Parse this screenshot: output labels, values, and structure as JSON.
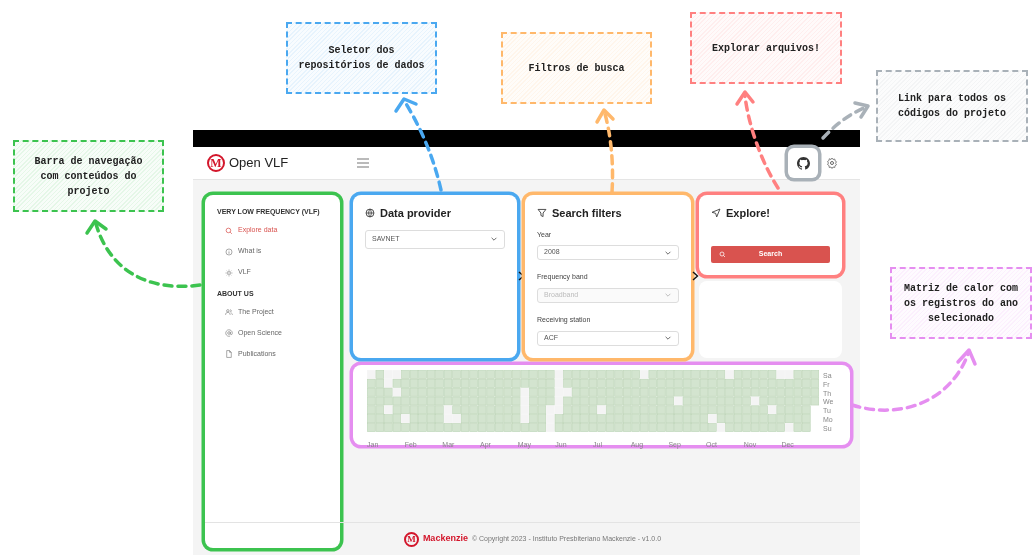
{
  "header": {
    "logo_letter": "M",
    "title": "Open VLF"
  },
  "sidebar": {
    "sections": [
      {
        "heading": "VERY LOW FREQUENCY (VLF)",
        "items": [
          {
            "label": "Explore data",
            "kind": "search",
            "selected": true
          },
          {
            "label": "What is",
            "kind": "info",
            "selected": false
          },
          {
            "label": "VLF",
            "kind": "sun",
            "selected": false
          }
        ]
      },
      {
        "heading": "ABOUT US",
        "items": [
          {
            "label": "The Project",
            "kind": "people",
            "selected": false
          },
          {
            "label": "Open Science",
            "kind": "at",
            "selected": false
          },
          {
            "label": "Publications",
            "kind": "file",
            "selected": false
          }
        ]
      }
    ]
  },
  "data_provider": {
    "title": "Data provider",
    "value": "SAVNET"
  },
  "search_filters": {
    "title": "Search filters",
    "fields": [
      {
        "label": "Year",
        "value": "2008",
        "disabled": false
      },
      {
        "label": "Frequency band",
        "value": "Broadband",
        "disabled": true
      },
      {
        "label": "Receiving station",
        "value": "ACF",
        "disabled": false
      }
    ]
  },
  "explore": {
    "title": "Explore!",
    "button": "Search"
  },
  "heatmap": {
    "months": [
      "Jan",
      "Feb",
      "Mar",
      "Apr",
      "May",
      "Jun",
      "Jul",
      "Aug",
      "Sep",
      "Oct",
      "Nov",
      "Dec"
    ],
    "days": [
      "Sa",
      "Fr",
      "Th",
      "We",
      "Tu",
      "Mo",
      "Su"
    ]
  },
  "footer": {
    "logo_letter": "M",
    "brand": "Mackenzie",
    "text": "© Copyright 2023 - Instituto Presbiteriano Mackenzie - v1.0.0"
  },
  "annotations": [
    {
      "kind": "provider",
      "text": "Seletor dos repositórios de dados",
      "color": "#4aa8f0"
    },
    {
      "kind": "filters",
      "text": "Filtros de busca",
      "color": "#ffb86b"
    },
    {
      "kind": "explore",
      "text": "Explorar arquivos!",
      "color": "#ff8080"
    },
    {
      "kind": "github",
      "text": "Link para todos os códigos do projeto",
      "color": "#a9b1b8"
    },
    {
      "kind": "sidebar",
      "text": "Barra de navegação com conteúdos do projeto",
      "color": "#3cc34f"
    },
    {
      "kind": "heatmap",
      "text": "Matriz de calor com os registros do ano selecionado",
      "color": "#e58ef0"
    }
  ]
}
